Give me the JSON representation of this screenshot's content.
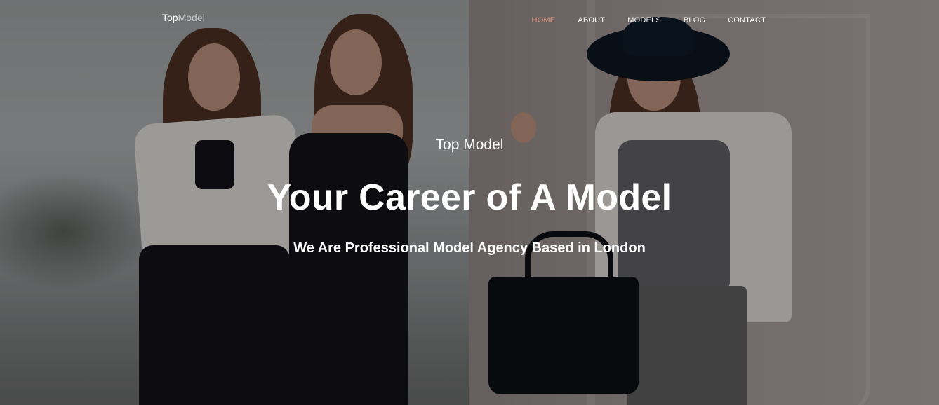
{
  "brand": {
    "part1": "Top",
    "part2": "Model"
  },
  "nav": {
    "items": [
      {
        "label": "HOME",
        "active": true
      },
      {
        "label": "ABOUT",
        "active": false
      },
      {
        "label": "MODELS",
        "active": false
      },
      {
        "label": "BLOG",
        "active": false
      },
      {
        "label": "CONTACT",
        "active": false
      }
    ]
  },
  "hero": {
    "kicker": "Top Model",
    "title": "Your Career of A Model",
    "subtitle": "We Are Professional Model Agency Based in London"
  },
  "colors": {
    "accent": "#e39a84",
    "text": "#ffffff"
  }
}
